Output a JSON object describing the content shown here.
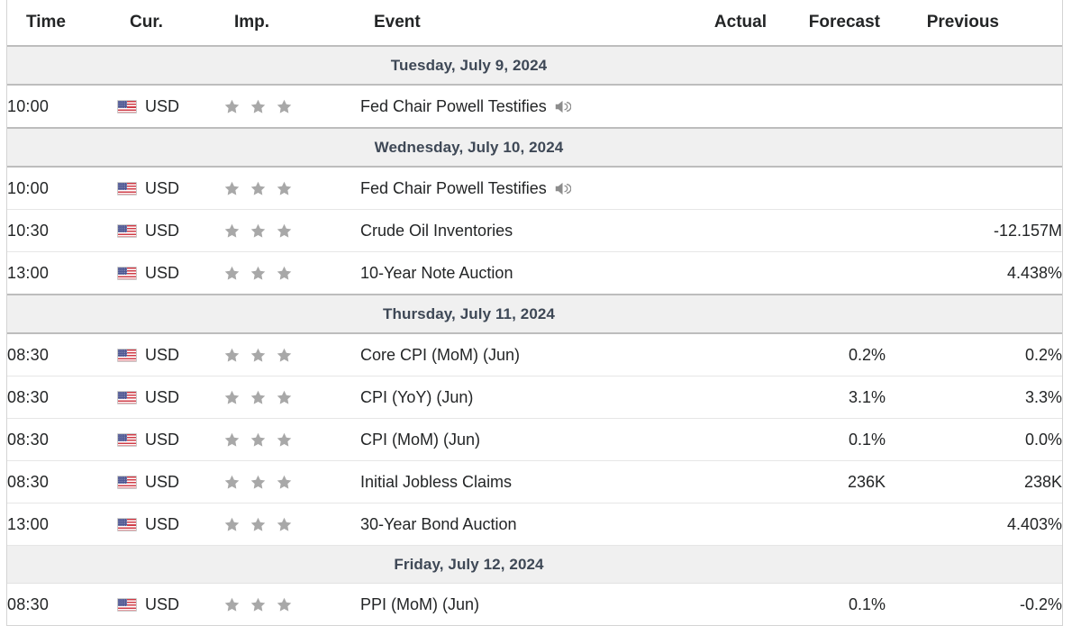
{
  "table": {
    "columns": [
      {
        "key": "time",
        "label": "Time"
      },
      {
        "key": "cur",
        "label": "Cur."
      },
      {
        "key": "imp",
        "label": "Imp."
      },
      {
        "key": "event",
        "label": "Event"
      },
      {
        "key": "actual",
        "label": "Actual"
      },
      {
        "key": "forecast",
        "label": "Forecast"
      },
      {
        "key": "previous",
        "label": "Previous"
      }
    ],
    "colors": {
      "date_header_text": "#3e4856",
      "date_header_bg": "#f0f0f0",
      "star_filled": "#a8a8a8",
      "row_border": "#e6e6e6",
      "text": "#232526"
    },
    "sections": [
      {
        "date": "Tuesday, July 9, 2024",
        "rows": [
          {
            "time": "10:00",
            "currency": "USD",
            "flag": "us-flag-icon",
            "importance": 3,
            "event": "Fed Chair Powell Testifies",
            "has_audio": true,
            "audio_icon": "speaker-icon",
            "actual": "",
            "forecast": "",
            "previous": ""
          }
        ]
      },
      {
        "date": "Wednesday, July 10, 2024",
        "rows": [
          {
            "time": "10:00",
            "currency": "USD",
            "flag": "us-flag-icon",
            "importance": 3,
            "event": "Fed Chair Powell Testifies",
            "has_audio": true,
            "audio_icon": "speaker-icon",
            "actual": "",
            "forecast": "",
            "previous": ""
          },
          {
            "time": "10:30",
            "currency": "USD",
            "flag": "us-flag-icon",
            "importance": 3,
            "event": "Crude Oil Inventories",
            "has_audio": false,
            "actual": "",
            "forecast": "",
            "previous": "-12.157M"
          },
          {
            "time": "13:00",
            "currency": "USD",
            "flag": "us-flag-icon",
            "importance": 3,
            "event": "10-Year Note Auction",
            "has_audio": false,
            "actual": "",
            "forecast": "",
            "previous": "4.438%"
          }
        ]
      },
      {
        "date": "Thursday, July 11, 2024",
        "rows": [
          {
            "time": "08:30",
            "currency": "USD",
            "flag": "us-flag-icon",
            "importance": 3,
            "event": "Core CPI (MoM) (Jun)",
            "has_audio": false,
            "actual": "",
            "forecast": "0.2%",
            "previous": "0.2%"
          },
          {
            "time": "08:30",
            "currency": "USD",
            "flag": "us-flag-icon",
            "importance": 3,
            "event": "CPI (YoY) (Jun)",
            "has_audio": false,
            "actual": "",
            "forecast": "3.1%",
            "previous": "3.3%"
          },
          {
            "time": "08:30",
            "currency": "USD",
            "flag": "us-flag-icon",
            "importance": 3,
            "event": "CPI (MoM) (Jun)",
            "has_audio": false,
            "actual": "",
            "forecast": "0.1%",
            "previous": "0.0%"
          },
          {
            "time": "08:30",
            "currency": "USD",
            "flag": "us-flag-icon",
            "importance": 3,
            "event": "Initial Jobless Claims",
            "has_audio": false,
            "actual": "",
            "forecast": "236K",
            "previous": "238K"
          },
          {
            "time": "13:00",
            "currency": "USD",
            "flag": "us-flag-icon",
            "importance": 3,
            "event": "30-Year Bond Auction",
            "has_audio": false,
            "actual": "",
            "forecast": "",
            "previous": "4.403%"
          }
        ]
      },
      {
        "date": "Friday, July 12, 2024",
        "rows": [
          {
            "time": "08:30",
            "currency": "USD",
            "flag": "us-flag-icon",
            "importance": 3,
            "event": "PPI (MoM) (Jun)",
            "has_audio": false,
            "actual": "",
            "forecast": "0.1%",
            "previous": "-0.2%"
          }
        ]
      }
    ]
  }
}
